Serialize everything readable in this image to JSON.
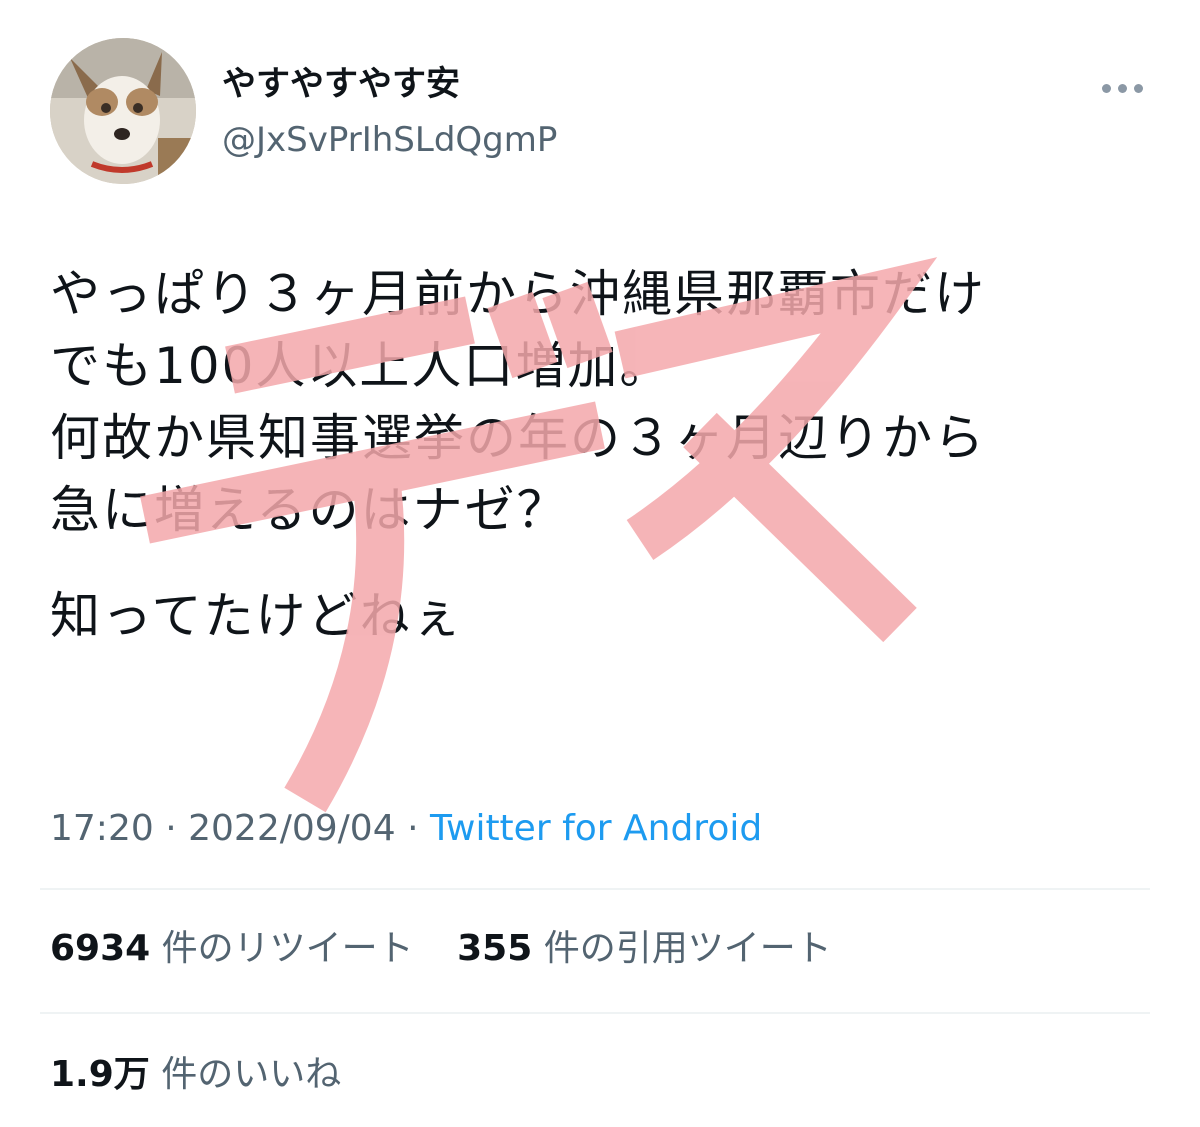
{
  "user": {
    "display_name": "やすやすやす安",
    "handle": "@JxSvPrIhSLdQgmP",
    "avatar_icon": "dog-avatar-icon"
  },
  "more_icon": "more-horizontal-icon",
  "tweet": {
    "lines": [
      "やっぱり３ヶ月前から沖縄県那覇市だけ",
      "でも100人以上人口増加。",
      "何故か県知事選挙の年の３ヶ月辺りから",
      "急に増えるのはナゼ？",
      "知ってたけどねぇ"
    ],
    "watermark_text": "デマ",
    "watermark_color": "#f4a8ab"
  },
  "meta": {
    "time": "17:20",
    "separator": "·",
    "date": "2022/09/04",
    "source": "Twitter for Android"
  },
  "stats": {
    "retweets_count": "6934",
    "retweets_label": "件のリツイート",
    "quotes_count": "355",
    "quotes_label": "件の引用ツイート",
    "likes_count": "1.9万",
    "likes_label": "件のいいね"
  },
  "colors": {
    "text": "#0f1419",
    "secondary": "#536471",
    "link": "#1d9bf0",
    "divider": "#eff3f4"
  }
}
